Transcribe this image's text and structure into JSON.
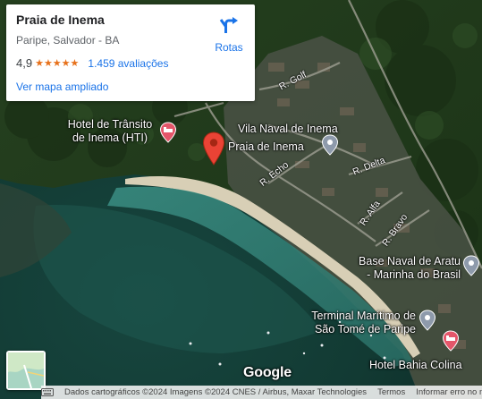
{
  "place_card": {
    "title": "Praia de Inema",
    "address": "Paripe, Salvador - BA",
    "rating": "4,9",
    "stars": "★★★★★",
    "reviews": "1.459 avaliações",
    "view_larger_map": "Ver mapa ampliado",
    "directions_label": "Rotas"
  },
  "map_labels": {
    "hotel_transito": "Hotel de Trânsito\nde Inema (HTI)",
    "vila_naval": "Vila Naval de Inema",
    "praia_inema": "Praia de Inema",
    "base_naval": "Base Naval de Aratu\n- Marinha do Brasil",
    "terminal_maritimo": "Terminal Marítimo de\nSão Tomé de Paripe",
    "hotel_bahia": "Hotel Bahia Colina"
  },
  "streets": {
    "golf": "R. Golf",
    "echo": "R. Echo",
    "delta": "R. Delta",
    "alfa": "R. Alfa",
    "bravo": "R. Bravo"
  },
  "attribution": {
    "logo": "Google",
    "map_data": "Dados cartográficos ©2024 Imagens ©2024 CNES / Airbus, Maxar Technologies",
    "terms": "Termos",
    "report": "Informar erro no mapa"
  },
  "colors": {
    "link_blue": "#1a73e8",
    "star_orange": "#e7711b",
    "pin_red": "#ea4335",
    "hotel_pink": "#e4566a",
    "poi_gray": "#8e9aab"
  }
}
